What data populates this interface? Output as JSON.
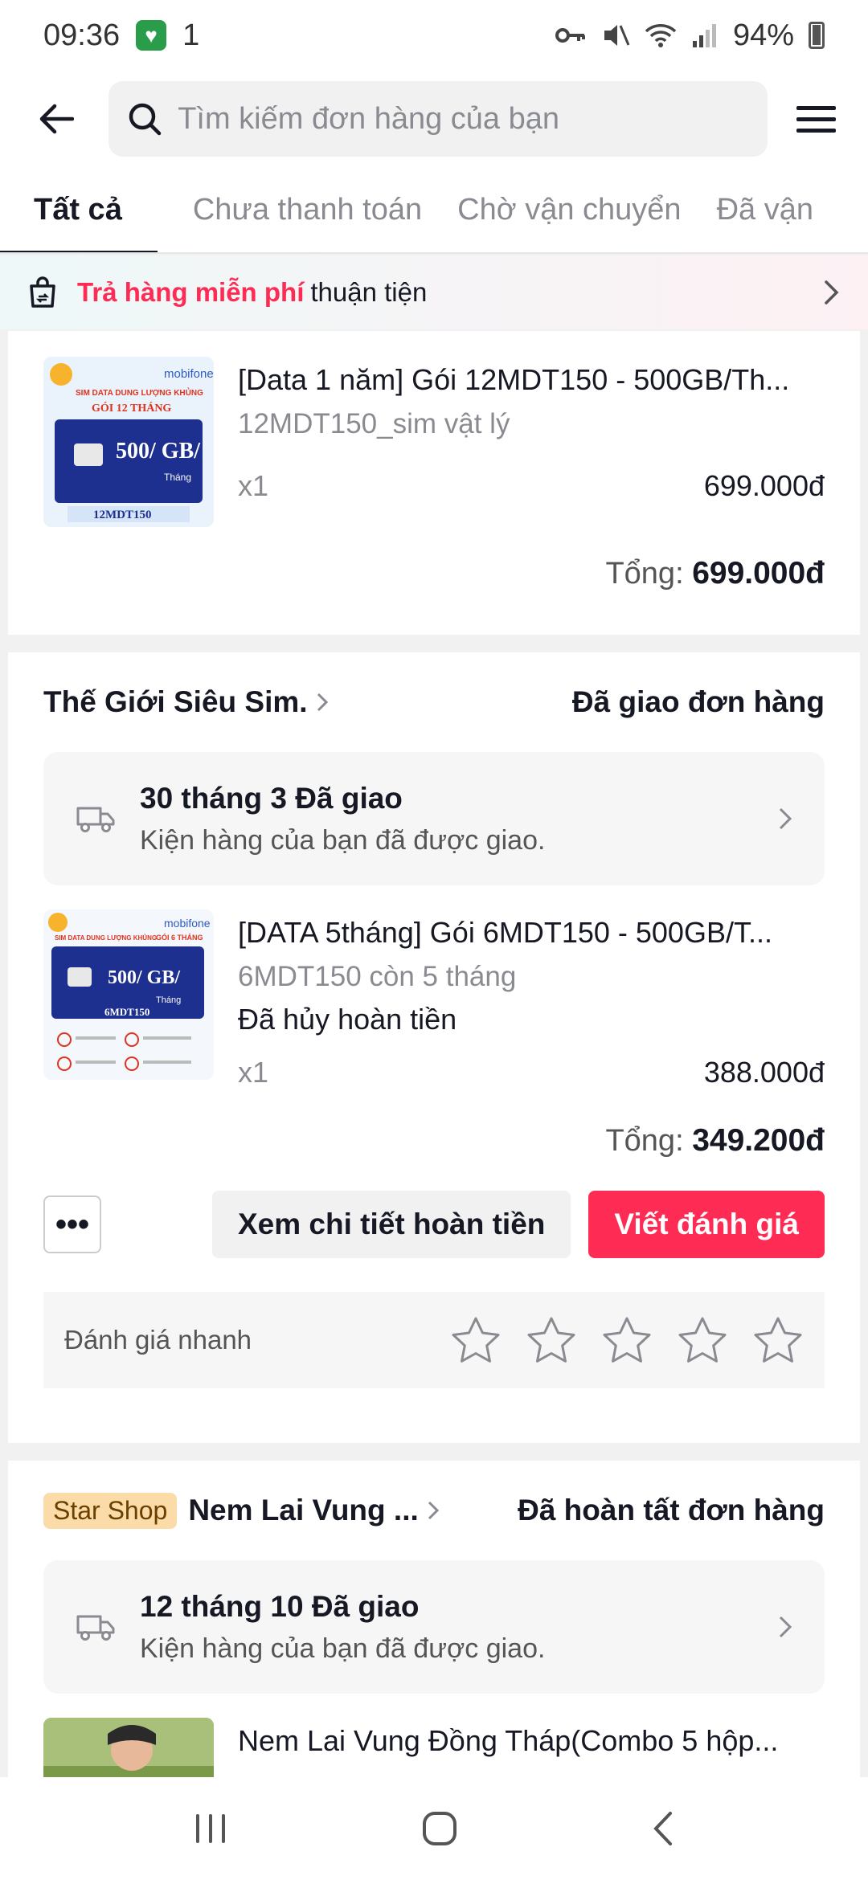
{
  "status_bar": {
    "time": "09:36",
    "notif": "1",
    "battery": "94%"
  },
  "header": {
    "search_placeholder": "Tìm kiếm đơn hàng của bạn"
  },
  "tabs": [
    {
      "label": "Tất cả",
      "active": true
    },
    {
      "label": "Chưa thanh toán"
    },
    {
      "label": "Chờ vận chuyển"
    },
    {
      "label": "Đã vận"
    }
  ],
  "banner": {
    "accent": "Trả hàng miễn phí",
    "rest": "thuận tiện"
  },
  "orders": [
    {
      "product": {
        "title": "[Data 1 năm] Gói 12MDT150 - 500GB/Th...",
        "variant": "12MDT150_sim vật lý",
        "qty": "x1",
        "price": "699.000đ",
        "thumb_code": "12MDT150",
        "thumb_plan": "GÓI 12 THÁNG",
        "thumb_gb": "500/ GB/",
        "thumb_period": "Tháng",
        "thumb_brand": "mobifone",
        "thumb_banner": "SIM DATA DUNG LƯỢNG KHỦNG"
      },
      "total_label": "Tổng:",
      "total_value": "699.000đ"
    },
    {
      "shop": "Thế Giới Siêu Sim.",
      "status": "Đã giao đơn hàng",
      "delivery": {
        "title": "30 tháng 3 Đã giao",
        "sub": "Kiện hàng của bạn đã được giao."
      },
      "product": {
        "title": "[DATA 5tháng] Gói 6MDT150 - 500GB/T...",
        "variant": "6MDT150 còn 5 tháng",
        "state": "Đã hủy hoàn tiền",
        "qty": "x1",
        "price": "388.000đ",
        "thumb_code": "6MDT150",
        "thumb_plan": "GÓI 6 THÁNG",
        "thumb_gb": "500/ GB/",
        "thumb_period": "Tháng",
        "thumb_brand": "mobifone",
        "thumb_banner": "SIM DATA DUNG LƯỢNG KHỦNG"
      },
      "total_label": "Tổng:",
      "total_value": "349.200đ",
      "more": "•••",
      "btn_refund": "Xem chi tiết hoàn tiền",
      "btn_review": "Viết đánh giá",
      "quick_rate": "Đánh giá nhanh"
    },
    {
      "badge": "Star Shop",
      "shop": "Nem Lai Vung ...",
      "status": "Đã hoàn tất đơn hàng",
      "delivery": {
        "title": "12 tháng 10 Đã giao",
        "sub": "Kiện hàng của bạn đã được giao."
      },
      "product": {
        "title": "Nem Lai Vung Đồng Tháp(Combo 5 hộp..."
      }
    }
  ],
  "colors": {
    "accent": "#fe2c55",
    "badge": "#fbdca8"
  }
}
